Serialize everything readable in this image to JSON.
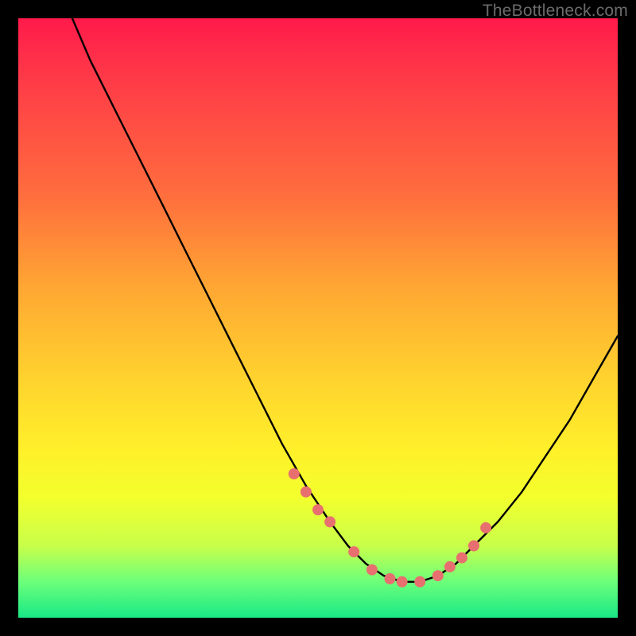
{
  "watermark": "TheBottleneck.com",
  "chart_data": {
    "type": "line",
    "title": "",
    "xlabel": "",
    "ylabel": "",
    "xlim": [
      0,
      100
    ],
    "ylim": [
      0,
      100
    ],
    "grid": false,
    "legend": false,
    "series": [
      {
        "name": "bottleneck-curve",
        "x": [
          9,
          12,
          16,
          20,
          24,
          28,
          32,
          36,
          40,
          44,
          48,
          52,
          55,
          58,
          61,
          64,
          67,
          70,
          73,
          76,
          80,
          84,
          88,
          92,
          96,
          100
        ],
        "y": [
          100,
          93,
          85,
          77,
          69,
          61,
          53,
          45,
          37,
          29,
          22,
          16,
          12,
          9,
          7,
          6,
          6,
          7,
          9,
          12,
          16,
          21,
          27,
          33,
          40,
          47
        ]
      }
    ],
    "markers": {
      "name": "highlight-points",
      "x": [
        46,
        48,
        50,
        52,
        56,
        59,
        62,
        64,
        67,
        70,
        72,
        74,
        76,
        78
      ],
      "y": [
        24,
        21,
        18,
        16,
        11,
        8,
        6.5,
        6,
        6,
        7,
        8.5,
        10,
        12,
        15
      ]
    }
  }
}
